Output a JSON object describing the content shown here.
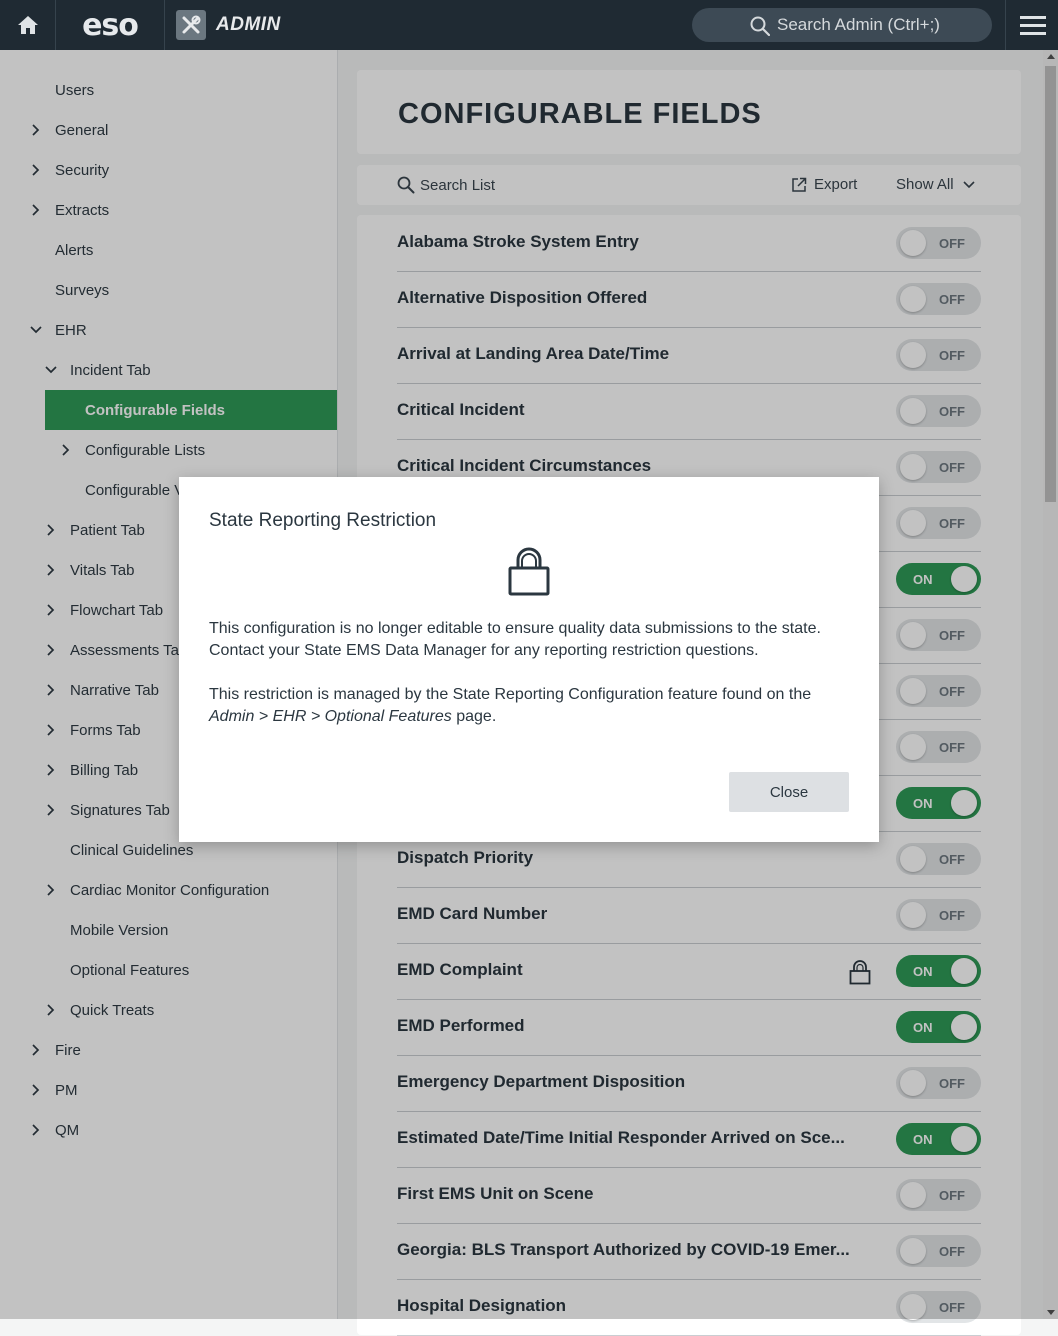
{
  "topbar": {
    "logo_text": "eso",
    "admin_label": "ADMIN",
    "search_placeholder": "Search Admin (Ctrl+;)",
    "icons": {
      "home": "home-icon",
      "admin": "tools-icon",
      "search": "search-icon",
      "menu": "hamburger-menu-icon"
    }
  },
  "sidebar": {
    "items": [
      {
        "label": "Users",
        "level": 0,
        "chevron": "none"
      },
      {
        "label": "General",
        "level": 0,
        "chevron": "right"
      },
      {
        "label": "Security",
        "level": 0,
        "chevron": "right"
      },
      {
        "label": "Extracts",
        "level": 0,
        "chevron": "right"
      },
      {
        "label": "Alerts",
        "level": 0,
        "chevron": "none"
      },
      {
        "label": "Surveys",
        "level": 0,
        "chevron": "none"
      },
      {
        "label": "EHR",
        "level": 0,
        "chevron": "down"
      },
      {
        "label": "Incident Tab",
        "level": 1,
        "chevron": "down"
      },
      {
        "label": "Configurable Fields",
        "level": 2,
        "chevron": "none",
        "active": true
      },
      {
        "label": "Configurable Lists",
        "level": 2,
        "chevron": "right"
      },
      {
        "label": "Configurable Values",
        "level": 2,
        "chevron": "none"
      },
      {
        "label": "Patient Tab",
        "level": 1,
        "chevron": "right"
      },
      {
        "label": "Vitals Tab",
        "level": 1,
        "chevron": "right"
      },
      {
        "label": "Flowchart Tab",
        "level": 1,
        "chevron": "right"
      },
      {
        "label": "Assessments Tab",
        "level": 1,
        "chevron": "right"
      },
      {
        "label": "Narrative Tab",
        "level": 1,
        "chevron": "right"
      },
      {
        "label": "Forms Tab",
        "level": 1,
        "chevron": "right"
      },
      {
        "label": "Billing Tab",
        "level": 1,
        "chevron": "right"
      },
      {
        "label": "Signatures Tab",
        "level": 1,
        "chevron": "right"
      },
      {
        "label": "Clinical Guidelines",
        "level": 1,
        "chevron": "none"
      },
      {
        "label": "Cardiac Monitor Configuration",
        "level": 1,
        "chevron": "right"
      },
      {
        "label": "Mobile Version",
        "level": 1,
        "chevron": "none"
      },
      {
        "label": "Optional Features",
        "level": 1,
        "chevron": "none"
      },
      {
        "label": "Quick Treats",
        "level": 1,
        "chevron": "right"
      },
      {
        "label": "Fire",
        "level": 0,
        "chevron": "right"
      },
      {
        "label": "PM",
        "level": 0,
        "chevron": "right"
      },
      {
        "label": "QM",
        "level": 0,
        "chevron": "right"
      }
    ]
  },
  "main": {
    "title": "CONFIGURABLE FIELDS",
    "toolbar": {
      "search_label": "Search List",
      "export_label": "Export",
      "show_label": "Show All"
    },
    "fields": [
      {
        "label": "Alabama Stroke System Entry",
        "state": "OFF",
        "locked": false
      },
      {
        "label": "Alternative Disposition Offered",
        "state": "OFF",
        "locked": false
      },
      {
        "label": "Arrival at Landing Area Date/Time",
        "state": "OFF",
        "locked": false
      },
      {
        "label": "Critical Incident",
        "state": "OFF",
        "locked": false
      },
      {
        "label": "Critical Incident Circumstances",
        "state": "OFF",
        "locked": false
      },
      {
        "label": "",
        "state": "OFF",
        "locked": false
      },
      {
        "label": "",
        "state": "ON",
        "locked": false
      },
      {
        "label": "",
        "state": "OFF",
        "locked": false
      },
      {
        "label": "",
        "state": "OFF",
        "locked": false
      },
      {
        "label": "",
        "state": "OFF",
        "locked": false
      },
      {
        "label": "",
        "state": "ON",
        "locked": false
      },
      {
        "label": "Dispatch Priority",
        "state": "OFF",
        "locked": false
      },
      {
        "label": "EMD Card Number",
        "state": "OFF",
        "locked": false
      },
      {
        "label": "EMD Complaint",
        "state": "ON",
        "locked": true
      },
      {
        "label": "EMD Performed",
        "state": "ON",
        "locked": false
      },
      {
        "label": "Emergency Department Disposition",
        "state": "OFF",
        "locked": false
      },
      {
        "label": "Estimated Date/Time Initial Responder Arrived on Sce...",
        "state": "ON",
        "locked": false
      },
      {
        "label": "First EMS Unit on Scene",
        "state": "OFF",
        "locked": false
      },
      {
        "label": "Georgia: BLS Transport Authorized by COVID-19 Emer...",
        "state": "OFF",
        "locked": false
      },
      {
        "label": "Hospital Designation",
        "state": "OFF",
        "locked": false
      }
    ]
  },
  "modal": {
    "title": "State Reporting Restriction",
    "icon": "padlock-icon",
    "paragraph1": "This configuration is no longer editable to ensure quality data submissions to the state. Contact your State EMS Data Manager for any reporting restriction questions.",
    "paragraph2_prefix": "This restriction is managed by the State Reporting Configuration feature found on the ",
    "paragraph2_path": "Admin > EHR > Optional Features",
    "paragraph2_suffix": " page.",
    "close_label": "Close"
  },
  "colors": {
    "topbar": "#1f2a33",
    "accent_green": "#2f9a57",
    "toggle_off": "#e2e5e7"
  }
}
